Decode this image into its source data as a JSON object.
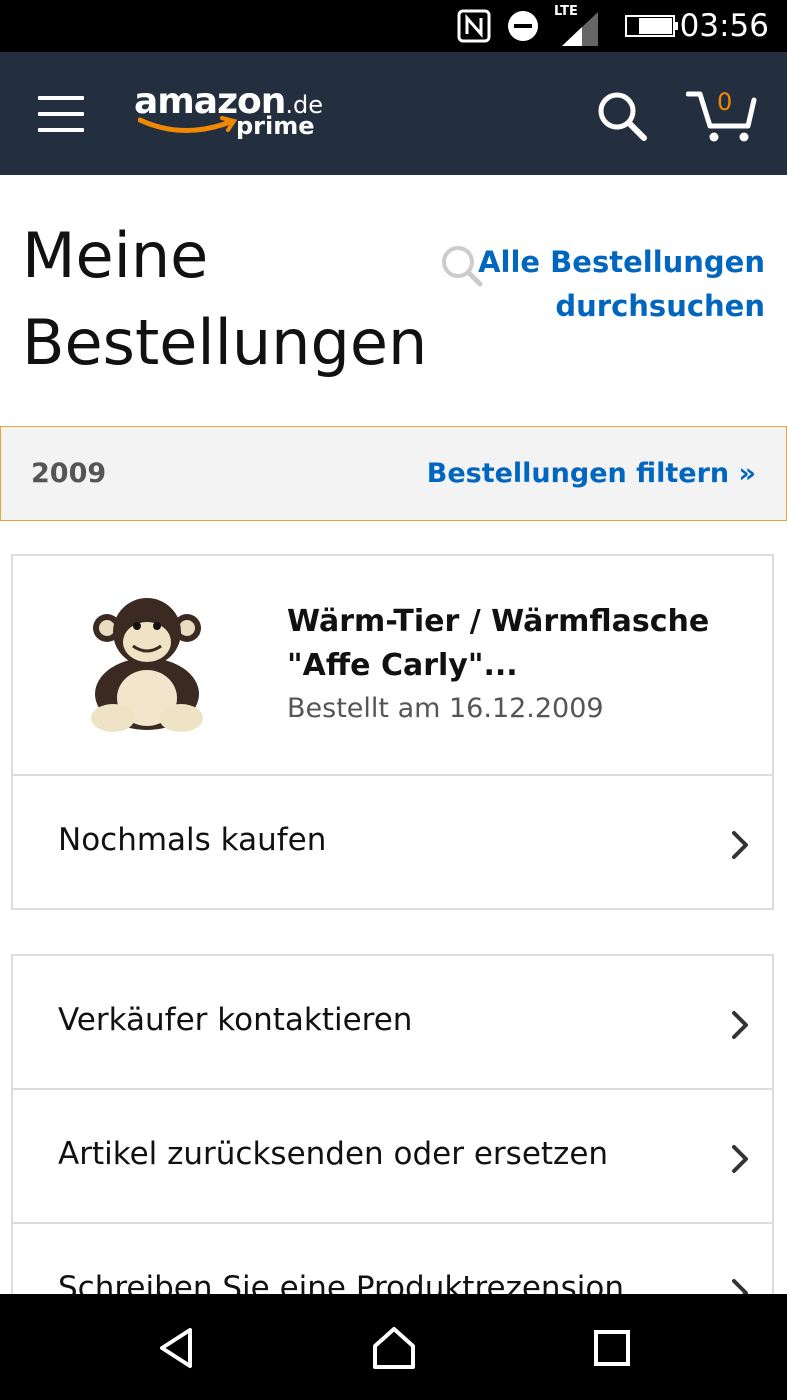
{
  "status_bar": {
    "time": "03:56",
    "network_label": "LTE",
    "icons": [
      "nfc-icon",
      "do-not-disturb-icon",
      "signal-icon",
      "battery-icon"
    ]
  },
  "header": {
    "logo_text": "amazon",
    "logo_tld": ".de",
    "logo_sub": "prime",
    "cart_count": "0",
    "colors": {
      "background": "#232f3e",
      "accent": "#f08804"
    }
  },
  "page": {
    "title": "Meine Bestellungen",
    "search_link": "Alle Bestellungen durchsuchen"
  },
  "filter": {
    "year": "2009",
    "link": "Bestellungen filtern »",
    "border_color": "#e8a33b"
  },
  "order": {
    "product_title": "Wärm-Tier / Wärmflasche \"Affe Carly\"...",
    "ordered_on": "Bestellt am 16.12.2009",
    "buy_again": "Nochmals kaufen"
  },
  "actions": [
    {
      "label": "Verkäufer kontaktieren"
    },
    {
      "label": "Artikel zurücksenden oder ersetzen"
    },
    {
      "label": "Schreiben Sie eine Produktrezension"
    }
  ],
  "link_color": "#0066c0"
}
